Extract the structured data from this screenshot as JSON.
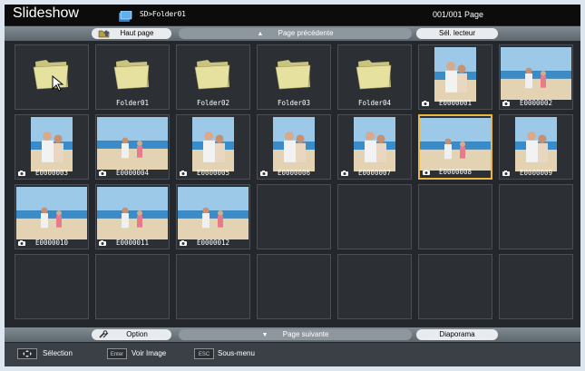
{
  "header": {
    "title": "Slideshow",
    "path": "SD>Folder01",
    "page_count": "001/001 Page"
  },
  "top_nav": {
    "home_label": "Haut page",
    "prev_label": "Page précédente",
    "reader_label": "Sél. lecteur"
  },
  "grid": {
    "items": [
      {
        "type": "folder",
        "label": ""
      },
      {
        "type": "folder",
        "label": "Folder01"
      },
      {
        "type": "folder",
        "label": "Folder02"
      },
      {
        "type": "folder",
        "label": "Folder03"
      },
      {
        "type": "folder",
        "label": "Folder04"
      },
      {
        "type": "image",
        "label": "E0000001",
        "photo": "portrait-beach"
      },
      {
        "type": "image",
        "label": "E0000002",
        "photo": "landscape-beach"
      },
      {
        "type": "image",
        "label": "E0000003",
        "photo": "portrait-couple"
      },
      {
        "type": "image",
        "label": "E0000004",
        "photo": "landscape-walk"
      },
      {
        "type": "image",
        "label": "E0000005",
        "photo": "portrait-woman"
      },
      {
        "type": "image",
        "label": "E0000006",
        "photo": "portrait-sea"
      },
      {
        "type": "image",
        "label": "E0000007",
        "photo": "portrait-family"
      },
      {
        "type": "image",
        "label": "E0000008",
        "photo": "landscape-sea-couple"
      },
      {
        "type": "image",
        "label": "E0000009",
        "photo": "portrait-kids"
      },
      {
        "type": "image",
        "label": "E0000010",
        "photo": "landscape-family-play"
      },
      {
        "type": "image",
        "label": "E0000011",
        "photo": "landscape-kids-surf"
      },
      {
        "type": "image",
        "label": "E0000012",
        "photo": "landscape-kids-walk"
      }
    ],
    "total_cells": 28,
    "selected_label": "E0000008"
  },
  "bottom_nav": {
    "option_label": "Option",
    "next_label": "Page suivante",
    "slideshow_label": "Diaporama"
  },
  "footer": {
    "selection_label": "Sélection",
    "enter_key": "Enter",
    "view_label": "Voir Image",
    "esc_key": "ESC",
    "submenu_label": "Sous-menu"
  },
  "colors": {
    "background": "#24272b",
    "selected_border": "#e8b840",
    "folder": "#e7e1a0"
  }
}
